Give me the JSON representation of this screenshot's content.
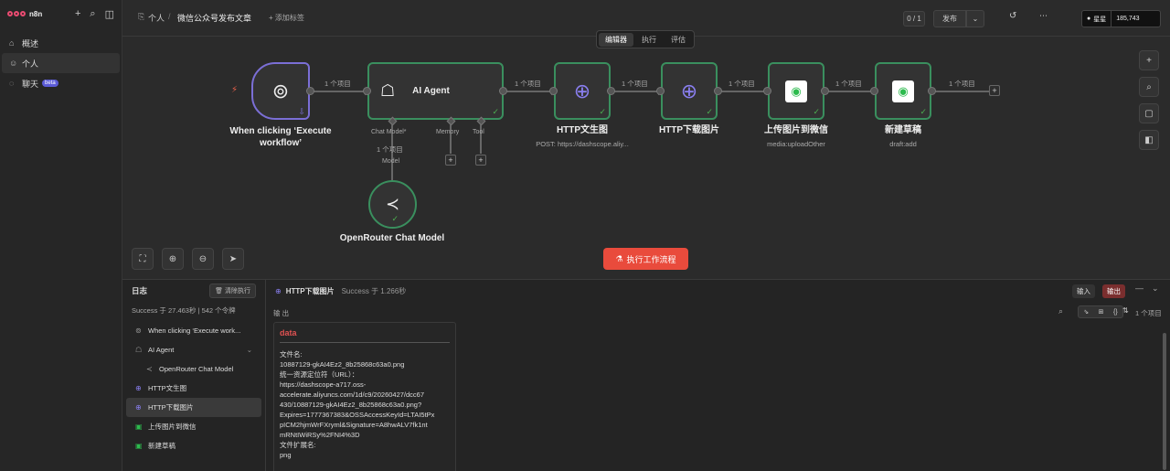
{
  "app": {
    "logo_text": "n8n"
  },
  "sidebar": {
    "items": [
      {
        "label": "概述",
        "icon": "home-icon"
      },
      {
        "label": "个人",
        "icon": "user-icon"
      },
      {
        "label": "聊天",
        "icon": "chat-icon",
        "badge": "beta"
      }
    ]
  },
  "header": {
    "project": "个人",
    "title": "微信公众号发布文章",
    "add_tag": "+ 添加标签",
    "counter": "0 / 1",
    "publish": "发布",
    "stars": "星星",
    "star_count": "185,743"
  },
  "tabs": [
    "编辑器",
    "执行",
    "评估"
  ],
  "canvas": {
    "nodes": {
      "trigger": {
        "label": "When clicking ‘Execute workflow’"
      },
      "agent": {
        "label": "AI Agent",
        "ports": [
          "Chat Model*",
          "Memory",
          "Tool"
        ]
      },
      "http1": {
        "label": "HTTP文生图",
        "sub": "POST: https://dashscope.aliy..."
      },
      "http2": {
        "label": "HTTP下载图片"
      },
      "upload": {
        "label": "上传图片到微信",
        "sub": "media:uploadOther"
      },
      "draft": {
        "label": "新建草稿",
        "sub": "draft:add"
      },
      "openrouter": {
        "label": "OpenRouter Chat Model",
        "port": "Model"
      }
    },
    "conn_label": "1 个项目",
    "run_button": "执行工作流程"
  },
  "logs": {
    "title": "日志",
    "clear": "清除执行",
    "status": "Success 于 27.463秒 | 542 个令牌",
    "items": [
      {
        "label": "When clicking ‘Execute work...",
        "icon": "cursor-icon"
      },
      {
        "label": "AI Agent",
        "icon": "robot-icon"
      },
      {
        "label": "OpenRouter Chat Model",
        "icon": "openrouter-icon"
      },
      {
        "label": "HTTP文生图",
        "icon": "globe-icon"
      },
      {
        "label": "HTTP下载图片",
        "icon": "globe-icon"
      },
      {
        "label": "上传图片到微信",
        "icon": "wechat-icon"
      },
      {
        "label": "新建草稿",
        "icon": "wechat-icon"
      }
    ]
  },
  "output": {
    "node": "HTTP下载图片",
    "status": "Success 于 1.266秒",
    "input_btn": "输入",
    "output_btn": "输出",
    "section": "输 出",
    "items": "1 个项目",
    "key": "data",
    "lines": [
      "文件名:",
      "10887129-gkAI4Ez2_8b25868c63a0.png",
      "统一资源定位符（URL）：",
      "https://dashscope-a717.oss-",
      "accelerate.aliyuncs.com/1d/c9/20260427/dcc67",
      "430/10887129-gkAI4Ez2_8b25868c63a0.png?",
      "Expires=1777367383&OSSAccessKeyId=LTAI5tPx",
      "pICM2hjmWrFXryml&Signature=A8hwALV7fk1nt",
      "mRNtIWiRSy%2FNI4%3D",
      "文件扩展名:",
      "png"
    ]
  }
}
